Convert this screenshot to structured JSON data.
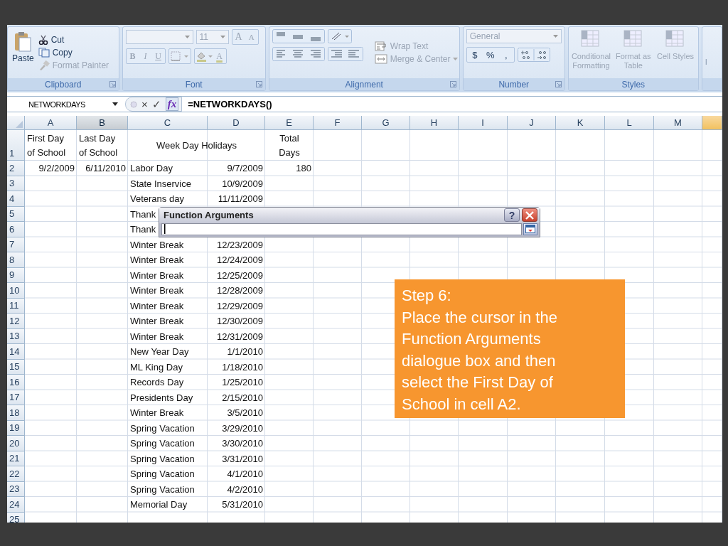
{
  "ribbon": {
    "clipboard": {
      "label": "Clipboard",
      "paste": {
        "label": "Paste",
        "disabled": false
      },
      "cut": {
        "label": "Cut",
        "disabled": false
      },
      "copy": {
        "label": "Copy",
        "disabled": false
      },
      "format_painter": {
        "label": "Format Painter",
        "disabled": true
      }
    },
    "font": {
      "label": "Font",
      "size": {
        "value": "11",
        "disabled": true
      },
      "grow": {
        "label": "A",
        "disabled": true
      },
      "shrink": {
        "label": "A",
        "disabled": true
      },
      "bold": {
        "label": "B",
        "disabled": true
      },
      "italic": {
        "label": "I",
        "disabled": true
      },
      "underline": {
        "label": "U",
        "disabled": true
      },
      "font_color": {
        "label": "A",
        "disabled": true
      }
    },
    "alignment": {
      "label": "Alignment",
      "wrap_text": {
        "label": "Wrap Text",
        "disabled": true
      },
      "merge": {
        "label": "Merge & Center",
        "disabled": true
      }
    },
    "number": {
      "label": "Number",
      "format": {
        "value": "General",
        "disabled": true
      },
      "currency": {
        "label": "$",
        "disabled": false
      },
      "percent": {
        "label": "%",
        "disabled": false
      },
      "comma": {
        "label": ",",
        "disabled": false
      }
    },
    "styles": {
      "label": "Styles",
      "buttons": [
        {
          "label": "Conditional Formatting",
          "disabled": true
        },
        {
          "label": "Format as Table",
          "disabled": true
        },
        {
          "label": "Cell Styles",
          "disabled": true
        }
      ]
    },
    "next_group": {
      "label": "I"
    }
  },
  "formula_bar": {
    "name_box": "NETWORKDAYS",
    "cancel": "×",
    "enter": "✓",
    "function": "fx",
    "formula": "=NETWORKDAYS()"
  },
  "columns": [
    {
      "letter": "A",
      "highlighted": false,
      "selected": false
    },
    {
      "letter": "B",
      "highlighted": true,
      "selected": false
    },
    {
      "letter": "C",
      "highlighted": false,
      "selected": false
    },
    {
      "letter": "D",
      "highlighted": false,
      "selected": false
    },
    {
      "letter": "E",
      "highlighted": false,
      "selected": false
    },
    {
      "letter": "F",
      "highlighted": false,
      "selected": false
    },
    {
      "letter": "G",
      "highlighted": false,
      "selected": false
    },
    {
      "letter": "H",
      "highlighted": false,
      "selected": false
    },
    {
      "letter": "I",
      "highlighted": false,
      "selected": false
    },
    {
      "letter": "J",
      "highlighted": false,
      "selected": false
    },
    {
      "letter": "K",
      "highlighted": false,
      "selected": false
    },
    {
      "letter": "L",
      "highlighted": false,
      "selected": false
    },
    {
      "letter": "M",
      "highlighted": false,
      "selected": false
    },
    {
      "highlighted": false,
      "selected": true
    }
  ],
  "rows": [
    {
      "number": "1",
      "kind": "header",
      "a": "First Day of School",
      "b": "Last Day of School",
      "cd": "Week Day Holidays",
      "e": "Total Days"
    },
    {
      "number": "2",
      "kind": "data",
      "a": "9/2/2009",
      "b": "6/11/2010",
      "c": "Labor Day",
      "d": "9/7/2009",
      "e": "180"
    },
    {
      "number": "3",
      "kind": "data",
      "c": "State Inservice",
      "d": "10/9/2009"
    },
    {
      "number": "4",
      "kind": "data",
      "c": "Veterans day",
      "d": "11/11/2009"
    },
    {
      "number": "5",
      "kind": "data",
      "c": "Thank"
    },
    {
      "number": "6",
      "kind": "data",
      "c": "Thank"
    },
    {
      "number": "7",
      "kind": "data",
      "c": "Winter Break",
      "d": "12/23/2009"
    },
    {
      "number": "8",
      "kind": "data",
      "c": "Winter Break",
      "d": "12/24/2009"
    },
    {
      "number": "9",
      "kind": "data",
      "c": "Winter Break",
      "d": "12/25/2009"
    },
    {
      "number": "10",
      "kind": "data",
      "c": "Winter Break",
      "d": "12/28/2009"
    },
    {
      "number": "11",
      "kind": "data",
      "c": "Winter Break",
      "d": "12/29/2009"
    },
    {
      "number": "12",
      "kind": "data",
      "c": "Winter Break",
      "d": "12/30/2009"
    },
    {
      "number": "13",
      "kind": "data",
      "c": "Winter Break",
      "d": "12/31/2009"
    },
    {
      "number": "14",
      "kind": "data",
      "c": "New Year Day",
      "d": "1/1/2010"
    },
    {
      "number": "15",
      "kind": "data",
      "c": "ML King Day",
      "d": "1/18/2010"
    },
    {
      "number": "16",
      "kind": "data",
      "c": "Records Day",
      "d": "1/25/2010"
    },
    {
      "number": "17",
      "kind": "data",
      "c": "Presidents Day",
      "d": "2/15/2010"
    },
    {
      "number": "18",
      "kind": "data",
      "c": "Winter Break",
      "d": "3/5/2010"
    },
    {
      "number": "19",
      "kind": "data",
      "c": "Spring Vacation",
      "d": "3/29/2010"
    },
    {
      "number": "20",
      "kind": "data",
      "c": "Spring Vacation",
      "d": "3/30/2010"
    },
    {
      "number": "21",
      "kind": "data",
      "c": "Spring Vacation",
      "d": "3/31/2010"
    },
    {
      "number": "22",
      "kind": "data",
      "c": "Spring Vacation",
      "d": "4/1/2010"
    },
    {
      "number": "23",
      "kind": "data",
      "c": "Spring Vacation",
      "d": "4/2/2010"
    },
    {
      "number": "24",
      "kind": "data",
      "c": "Memorial Day",
      "d": "5/31/2010"
    },
    {
      "number": "25",
      "kind": "data"
    }
  ],
  "dialog": {
    "title": "Function Arguments",
    "help": "?"
  },
  "callout": {
    "title": "Step 6:",
    "text": "Place the cursor in the Function Arguments dialogue box and then select the First Day of School in cell A2."
  }
}
